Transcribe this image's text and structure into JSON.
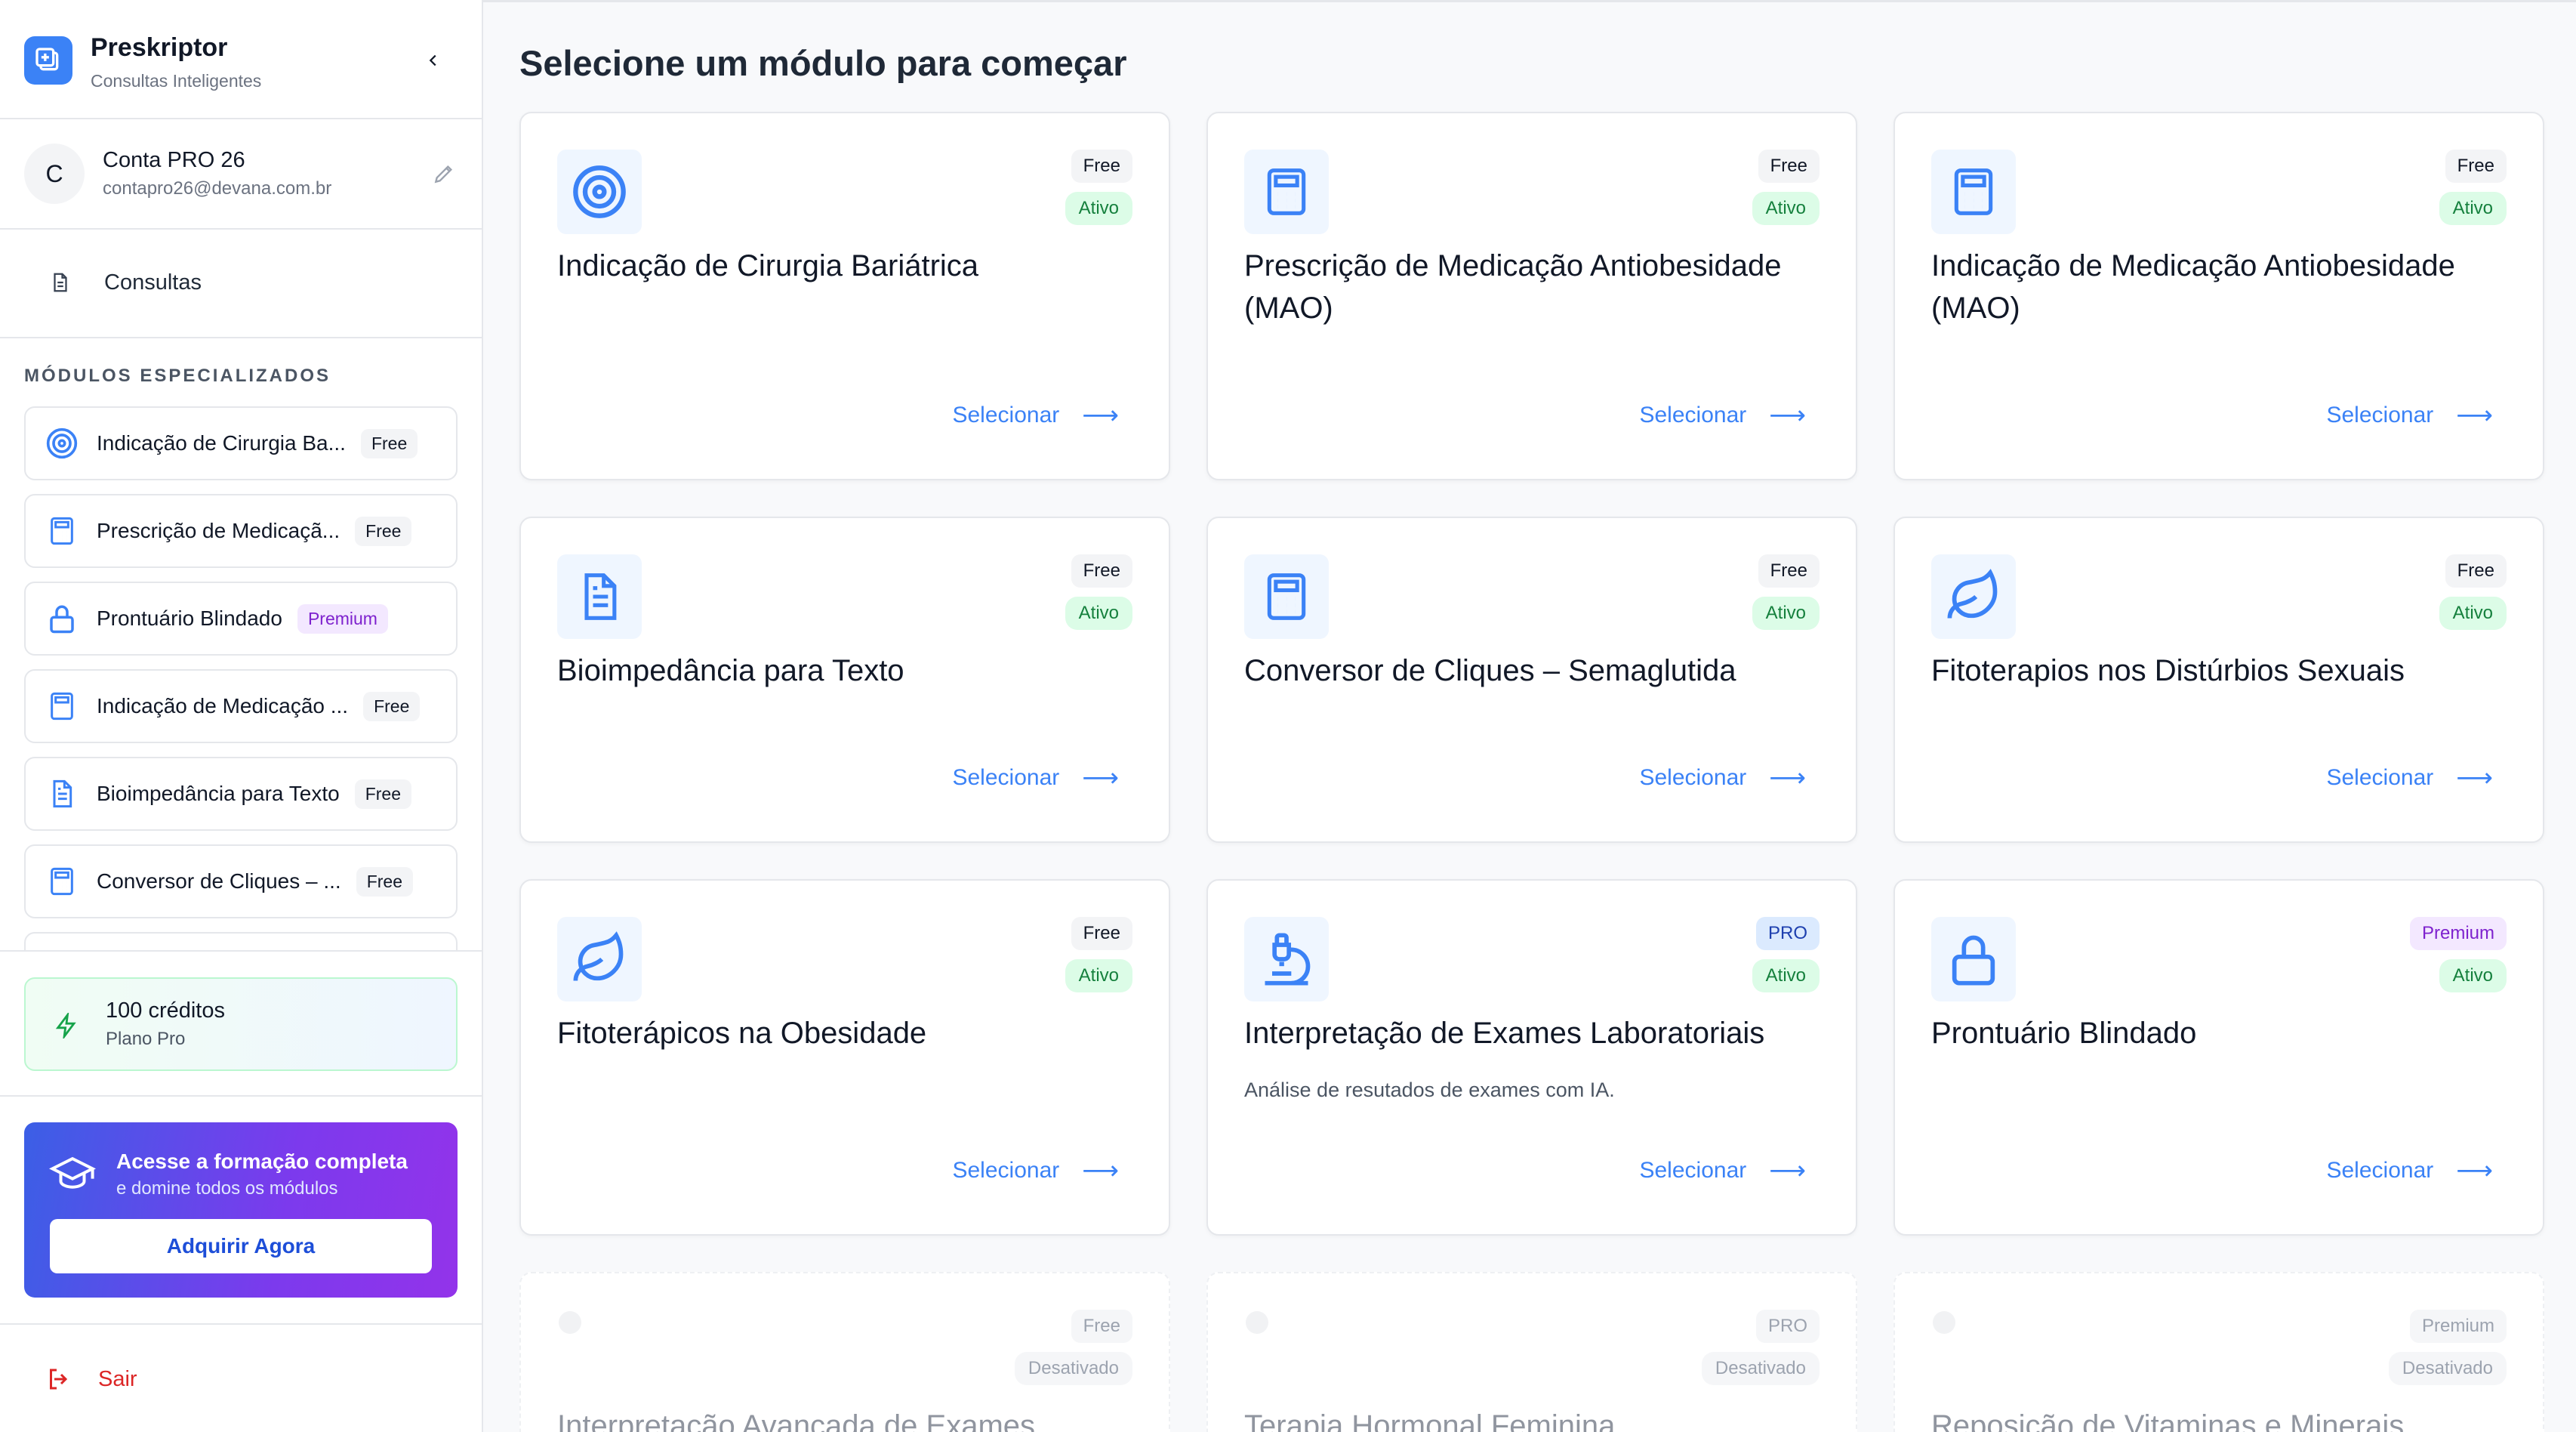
{
  "app": {
    "title": "Preskriptor",
    "subtitle": "Consultas Inteligentes"
  },
  "user": {
    "initial": "C",
    "name": "Conta PRO 26",
    "email": "contapro26@devana.com.br"
  },
  "nav": {
    "consultas": "Consultas"
  },
  "sidebar_modules": {
    "section_title": "MÓDULOS ESPECIALIZADOS",
    "items": [
      {
        "label": "Indicação de Cirurgia Ba...",
        "tag": "Free",
        "icon": "target-icon"
      },
      {
        "label": "Prescrição de Medicaçã...",
        "tag": "Free",
        "icon": "calculator-icon"
      },
      {
        "label": "Prontuário Blindado",
        "tag": "Premium",
        "icon": "lock-icon"
      },
      {
        "label": "Indicação de Medicação ...",
        "tag": "Free",
        "icon": "calculator-icon"
      },
      {
        "label": "Bioimpedância para Texto",
        "tag": "Free",
        "icon": "document-icon"
      },
      {
        "label": "Conversor de Cliques – ...",
        "tag": "Free",
        "icon": "calculator-icon"
      }
    ]
  },
  "credits": {
    "amount": "100 créditos",
    "plan": "Plano Pro"
  },
  "promo": {
    "title": "Acesse a formação completa",
    "subtitle": "e domine todos os módulos",
    "button": "Adquirir Agora"
  },
  "logout": "Sair",
  "main": {
    "title": "Selecione um módulo para começar",
    "select_label": "Selecionar",
    "cards": [
      {
        "title": "Indicação de Cirurgia Bariátrica",
        "plan": "Free",
        "status": "Ativo",
        "icon": "target-icon",
        "description": ""
      },
      {
        "title": "Prescrição de Medicação Antiobesidade (MAO)",
        "plan": "Free",
        "status": "Ativo",
        "icon": "calculator-icon",
        "description": ""
      },
      {
        "title": "Indicação de Medicação Antiobesidade (MAO)",
        "plan": "Free",
        "status": "Ativo",
        "icon": "calculator-icon",
        "description": ""
      },
      {
        "title": "Bioimpedância para Texto",
        "plan": "Free",
        "status": "Ativo",
        "icon": "document-icon",
        "description": ""
      },
      {
        "title": "Conversor de Cliques – Semaglutida",
        "plan": "Free",
        "status": "Ativo",
        "icon": "calculator-icon",
        "description": ""
      },
      {
        "title": "Fitoterapios nos Distúrbios Sexuais",
        "plan": "Free",
        "status": "Ativo",
        "icon": "leaf-icon",
        "description": ""
      },
      {
        "title": "Fitoterápicos na Obesidade",
        "plan": "Free",
        "status": "Ativo",
        "icon": "leaf-icon",
        "description": ""
      },
      {
        "title": "Interpretação de Exames Laboratoriais",
        "plan": "PRO",
        "status": "Ativo",
        "icon": "microscope-icon",
        "description": "Análise de resutados de exames com IA."
      },
      {
        "title": "Prontuário Blindado",
        "plan": "Premium",
        "status": "Ativo",
        "icon": "lock-icon",
        "description": ""
      },
      {
        "title": "Interpretação Avançada de Exames",
        "plan": "Free",
        "status": "Desativado",
        "icon": "",
        "description": ""
      },
      {
        "title": "Terapia Hormonal Feminina",
        "plan": "PRO",
        "status": "Desativado",
        "icon": "",
        "description": ""
      },
      {
        "title": "Reposição de Vitaminas e Minerais",
        "plan": "Premium",
        "status": "Desativado",
        "icon": "",
        "description": ""
      }
    ]
  },
  "colors": {
    "accent": "#3b82f6",
    "active_badge": "#15803d",
    "premium": "#7e22ce",
    "logout": "#dc2626"
  }
}
